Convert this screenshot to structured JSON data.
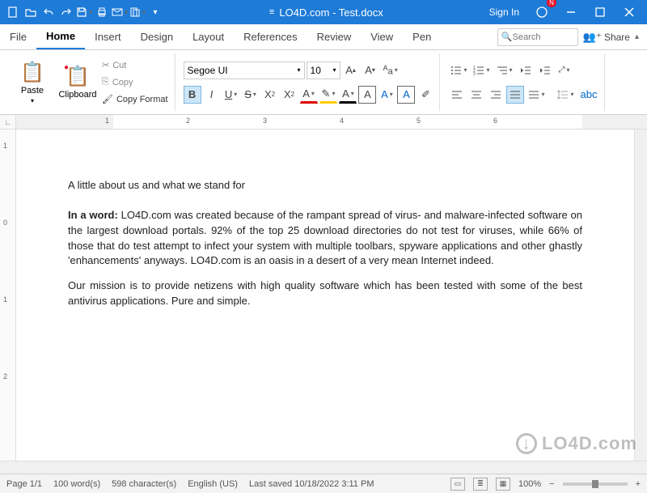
{
  "titlebar": {
    "title": "LO4D.com - Test.docx",
    "signin": "Sign In",
    "notif_badge": "N"
  },
  "menu": {
    "tabs": [
      "File",
      "Home",
      "Insert",
      "Design",
      "Layout",
      "References",
      "Review",
      "View",
      "Pen"
    ],
    "active": 1,
    "search_placeholder": "Search",
    "share": "Share"
  },
  "ribbon": {
    "paste": "Paste",
    "clipboard": "Clipboard",
    "cut": "Cut",
    "copy": "Copy",
    "copy_format": "Copy Format",
    "font_name": "Segoe UI",
    "font_size": "10"
  },
  "ruler": {
    "h_marks": [
      "1",
      "2",
      "3",
      "4",
      "5",
      "6"
    ],
    "v_marks": [
      "1",
      "0",
      "1",
      "2"
    ]
  },
  "document": {
    "subtitle": "A little about us and what we stand for",
    "p1_lead": "In a word:",
    "p1_body": " LO4D.com was created because of the rampant spread of virus- and malware-infected software on the largest download portals. 92% of the top 25 download directories do not test for viruses, while 66% of those that do test attempt to infect your system with multiple toolbars, spyware applications and other ghastly 'enhancements' anyways. LO4D.com is an oasis in a desert of a very mean Internet indeed.",
    "p2": "Our mission is to provide netizens with high quality software which has been tested with some of the best antivirus applications. Pure and simple."
  },
  "status": {
    "page": "Page 1/1",
    "words": "100 word(s)",
    "chars": "598 character(s)",
    "lang": "English (US)",
    "saved": "Last saved 10/18/2022 3:11 PM",
    "zoom": "100%"
  },
  "watermark": "LO4D.com"
}
